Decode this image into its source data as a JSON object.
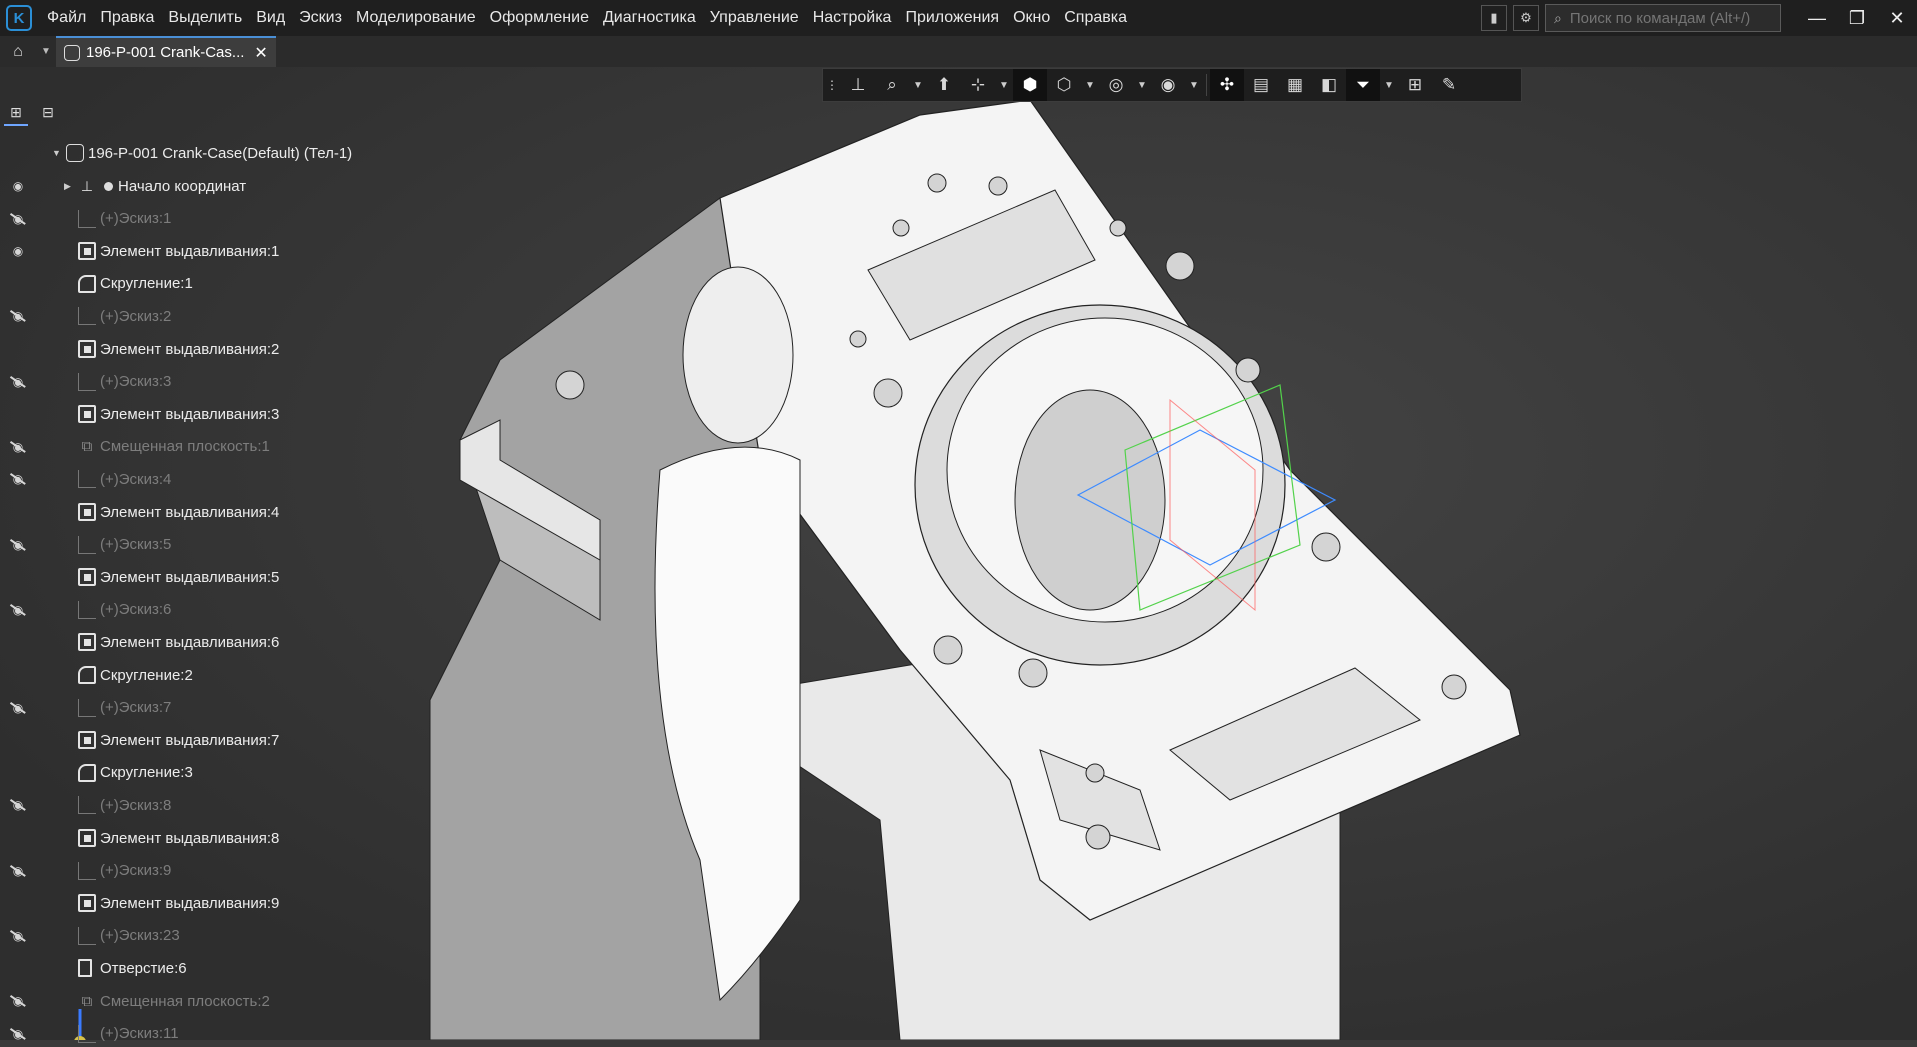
{
  "menu": {
    "items": [
      "Файл",
      "Правка",
      "Выделить",
      "Вид",
      "Эскиз",
      "Моделирование",
      "Оформление",
      "Диагностика",
      "Управление",
      "Настройка",
      "Приложения",
      "Окно",
      "Справка"
    ],
    "search_placeholder": "Поиск по командам (Alt+/)"
  },
  "tabs": {
    "document_title": "196-P-001 Crank-Cas..."
  },
  "tree": {
    "root_label": "196-P-001 Crank-Case(Default) (Тел-1)",
    "rows": [
      {
        "label": "Начало координат",
        "icon": "origin-icon",
        "visible": true,
        "dim": false
      },
      {
        "label": "(+)Эскиз:1",
        "icon": "sketch-icon",
        "visible": false,
        "dim": true
      },
      {
        "label": "Элемент выдавливания:1",
        "icon": "extrude-icon",
        "visible": true,
        "dim": false
      },
      {
        "label": "Скругление:1",
        "icon": "fillet-icon",
        "visible": null,
        "dim": false
      },
      {
        "label": "(+)Эскиз:2",
        "icon": "sketch-icon",
        "visible": false,
        "dim": true
      },
      {
        "label": "Элемент выдавливания:2",
        "icon": "extrude-icon",
        "visible": null,
        "dim": false
      },
      {
        "label": "(+)Эскиз:3",
        "icon": "sketch-icon",
        "visible": false,
        "dim": true
      },
      {
        "label": "Элемент выдавливания:3",
        "icon": "extrude-icon",
        "visible": null,
        "dim": false
      },
      {
        "label": "Смещенная плоскость:1",
        "icon": "plane-icon",
        "visible": false,
        "dim": true
      },
      {
        "label": "(+)Эскиз:4",
        "icon": "sketch-icon",
        "visible": false,
        "dim": true
      },
      {
        "label": "Элемент выдавливания:4",
        "icon": "extrude-icon",
        "visible": null,
        "dim": false
      },
      {
        "label": "(+)Эскиз:5",
        "icon": "sketch-icon",
        "visible": false,
        "dim": true
      },
      {
        "label": "Элемент выдавливания:5",
        "icon": "extrude-icon",
        "visible": null,
        "dim": false
      },
      {
        "label": "(+)Эскиз:6",
        "icon": "sketch-icon",
        "visible": false,
        "dim": true
      },
      {
        "label": "Элемент выдавливания:6",
        "icon": "extrude-icon",
        "visible": null,
        "dim": false
      },
      {
        "label": "Скругление:2",
        "icon": "fillet-icon",
        "visible": null,
        "dim": false
      },
      {
        "label": "(+)Эскиз:7",
        "icon": "sketch-icon",
        "visible": false,
        "dim": true
      },
      {
        "label": "Элемент выдавливания:7",
        "icon": "extrude-icon",
        "visible": null,
        "dim": false
      },
      {
        "label": "Скругление:3",
        "icon": "fillet-icon",
        "visible": null,
        "dim": false
      },
      {
        "label": "(+)Эскиз:8",
        "icon": "sketch-icon",
        "visible": false,
        "dim": true
      },
      {
        "label": "Элемент выдавливания:8",
        "icon": "extrude-icon",
        "visible": null,
        "dim": false
      },
      {
        "label": "(+)Эскиз:9",
        "icon": "sketch-icon",
        "visible": false,
        "dim": true
      },
      {
        "label": "Элемент выдавливания:9",
        "icon": "extrude-icon",
        "visible": null,
        "dim": false
      },
      {
        "label": "(+)Эскиз:23",
        "icon": "sketch-icon",
        "visible": false,
        "dim": true
      },
      {
        "label": "Отверстие:6",
        "icon": "hole-icon",
        "visible": null,
        "dim": false
      },
      {
        "label": "Смещенная плоскость:2",
        "icon": "plane-icon",
        "visible": false,
        "dim": true
      },
      {
        "label": "(+)Эскиз:11",
        "icon": "sketch-icon",
        "visible": false,
        "dim": true
      }
    ]
  },
  "colors": {
    "background": "#3a3a3a",
    "menubar": "#1f1f1f",
    "accent": "#2b8fd6",
    "model_face": "#f2f2f2",
    "model_shadow": "#9c9c9c"
  }
}
